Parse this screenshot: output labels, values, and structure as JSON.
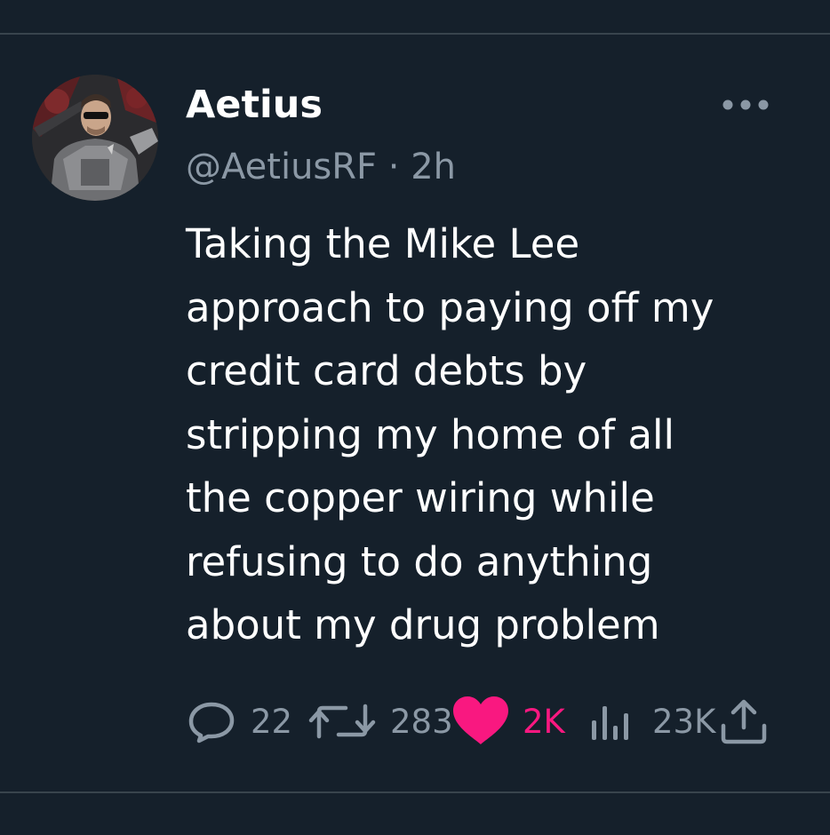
{
  "author": {
    "display_name": "Aetius",
    "handle": "@AetiusRF",
    "separator": "·",
    "time": "2h",
    "avatar_icon": "profile-photo-armored-man"
  },
  "menu": {
    "icon": "more-horizontal-icon"
  },
  "tweet": {
    "lines": [
      "Taking the Mike Lee",
      "approach to paying off my",
      "credit card debts by",
      "stripping my home of all",
      "the copper wiring while",
      "refusing to do anything",
      "about my drug problem"
    ]
  },
  "actions": {
    "replies": {
      "icon": "reply-bubble-icon",
      "count": "22"
    },
    "reposts": {
      "icon": "repost-arrows-icon",
      "count": "283"
    },
    "likes": {
      "icon": "heart-filled-icon",
      "count": "2K",
      "active": true
    },
    "views": {
      "icon": "analytics-bars-icon",
      "count": "23K"
    },
    "share": {
      "icon": "share-upload-icon"
    }
  },
  "colors": {
    "background": "#15202b",
    "divider": "#38444d",
    "secondary_text": "#8b98a5",
    "like_pink": "#f91880"
  }
}
